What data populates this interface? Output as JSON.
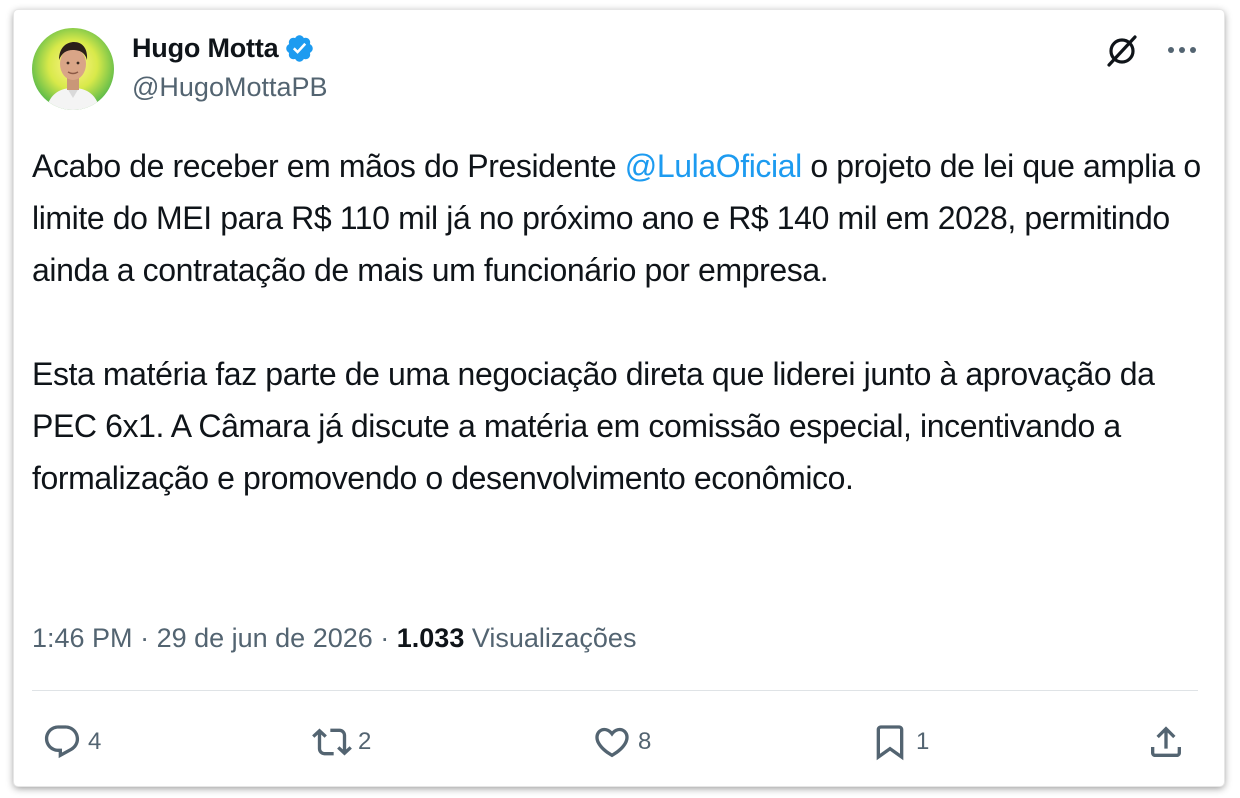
{
  "author": {
    "display_name": "Hugo Motta",
    "handle": "@HugoMottaPB",
    "verified_color": "#1d9bf0"
  },
  "tweet": {
    "p1_before": "Acabo de receber em mãos do Presidente ",
    "p1_mention": "@LulaOficial",
    "p1_after": " o projeto de lei que amplia o limite do MEI para R$ 110 mil já no próximo ano e R$ 140 mil em 2028, permitindo ainda a contratação de mais um funcionário por empresa.",
    "p2": "Esta matéria faz parte de uma negociação direta que liderei junto à aprovação da PEC 6x1. A Câmara já discute a matéria em comissão especial, incentivando a formalização e promovendo o desenvolvimento econômico."
  },
  "meta": {
    "time": "1:46 PM",
    "sep1": " · ",
    "date": "29 de jun de 2026",
    "sep2": " · ",
    "views_count": "1.033",
    "views_label": " Visualizações"
  },
  "actions": {
    "reply_count": "4",
    "repost_count": "2",
    "like_count": "8",
    "bookmark_count": "1"
  },
  "icons": {
    "top_right": [
      "grok-icon",
      "more-icon"
    ],
    "actions": [
      "reply-icon",
      "repost-icon",
      "like-icon",
      "bookmark-icon",
      "share-icon"
    ]
  },
  "colors": {
    "text": "#0f1419",
    "secondary": "#536471",
    "link": "#1d9bf0"
  }
}
